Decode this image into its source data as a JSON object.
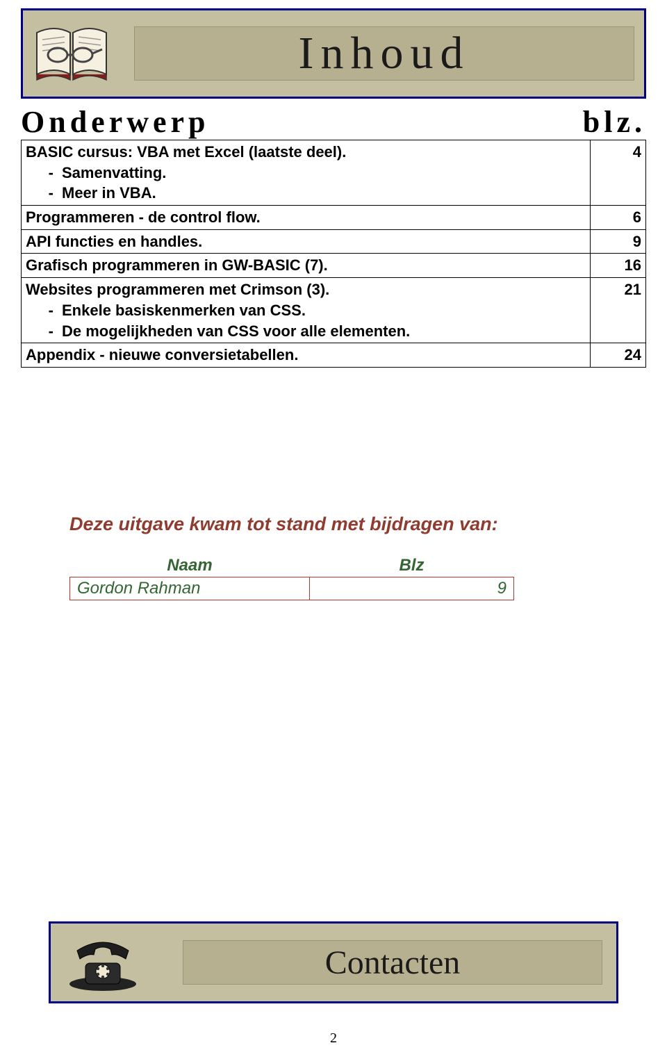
{
  "header": {
    "title": "Inhoud"
  },
  "toc": {
    "subject_label": "Onderwerp",
    "page_label": "blz.",
    "rows": [
      {
        "title": "BASIC cursus: VBA met Excel (laatste deel).",
        "sub1": "Samenvatting.",
        "sub2": "Meer in VBA.",
        "page": "4"
      },
      {
        "title": "Programmeren - de control flow.",
        "page": "6"
      },
      {
        "title": "API functies en handles.",
        "page": "9"
      },
      {
        "title": "Grafisch programmeren in GW-BASIC (7).",
        "page": "16"
      },
      {
        "title": "Websites programmeren met Crimson (3).",
        "sub1": "Enkele basiskenmerken van CSS.",
        "sub2": "De mogelijkheden van CSS voor alle elementen.",
        "page": "21"
      },
      {
        "title": "Appendix - nieuwe conversietabellen.",
        "page": "24"
      }
    ]
  },
  "credits": {
    "title": "Deze uitgave kwam tot stand met bijdragen van:",
    "name_header": "Naam",
    "blz_header": "Blz",
    "rows": [
      {
        "name": "Gordon Rahman",
        "blz": "9"
      }
    ]
  },
  "footer": {
    "title": "Contacten"
  },
  "page_number": "2"
}
